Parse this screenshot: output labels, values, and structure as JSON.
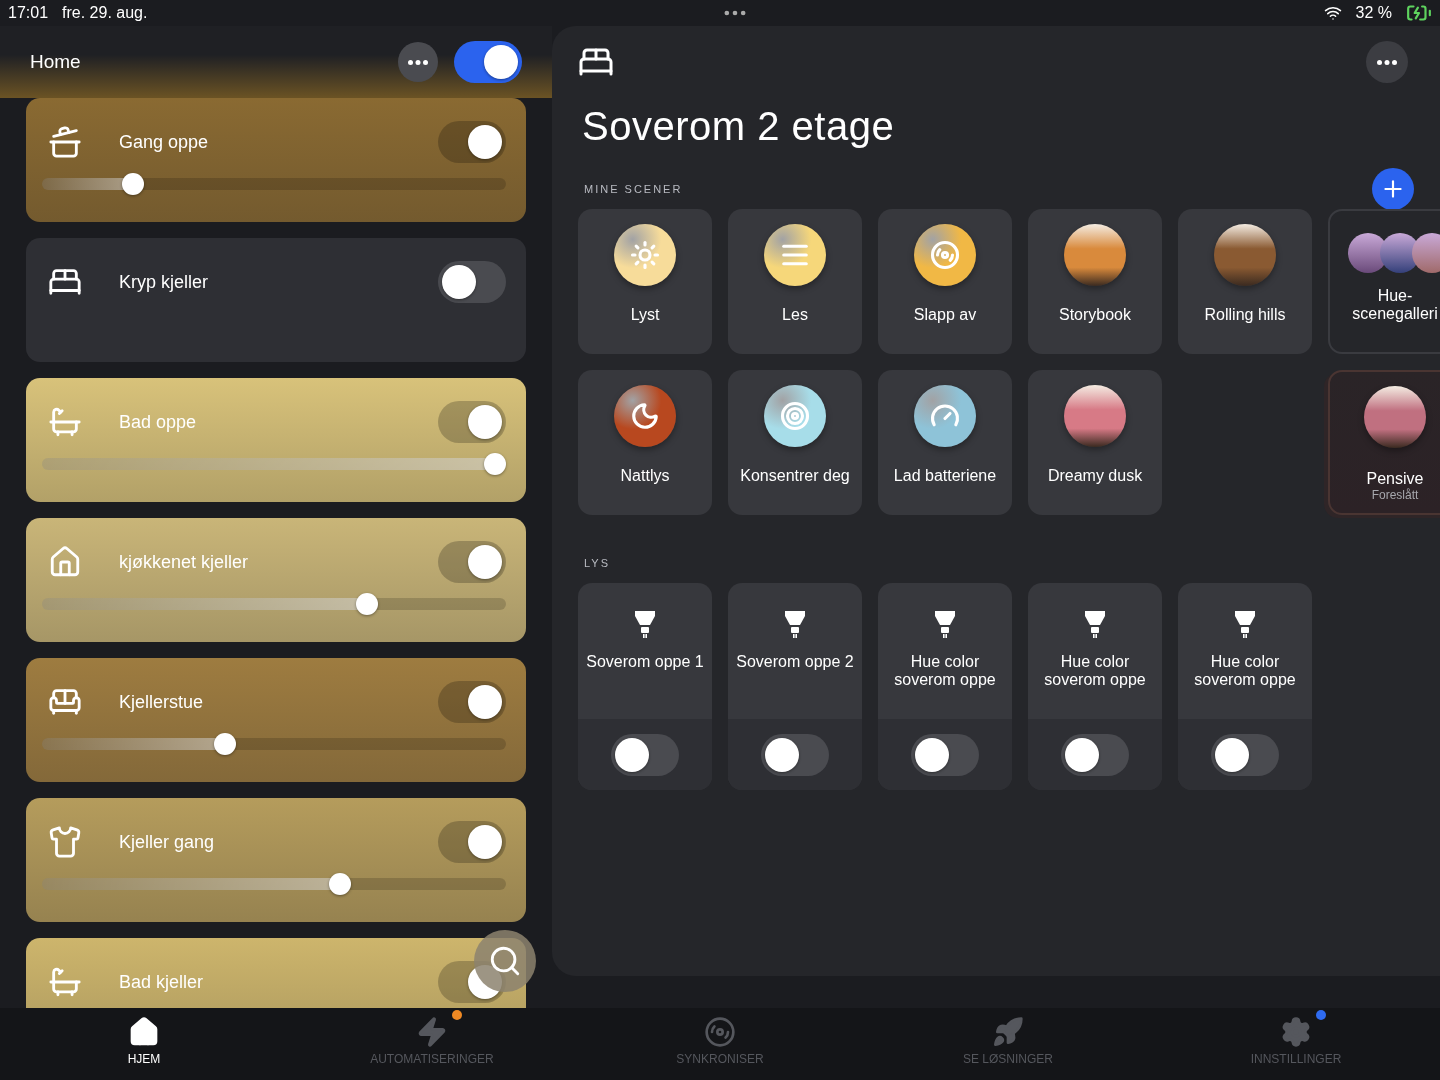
{
  "status_bar": {
    "time": "17:01",
    "date": "fre. 29. aug.",
    "battery": "32 %"
  },
  "home": {
    "title": "Home",
    "on": true
  },
  "rooms": [
    {
      "name": "Gang oppe",
      "kind": "pot",
      "on": true,
      "level": 0.18,
      "color": "#8a6a32"
    },
    {
      "name": "Kryp kjeller",
      "kind": "bed",
      "on": false,
      "color": "#2e2f34"
    },
    {
      "name": "Bad oppe",
      "kind": "bath",
      "on": true,
      "level": 1.0,
      "color": "#d8c27a"
    },
    {
      "name": "kjøkkenet kjeller",
      "kind": "house",
      "on": true,
      "level": 0.71,
      "color": "#c9b578"
    },
    {
      "name": "Kjellerstue",
      "kind": "sofa",
      "on": true,
      "level": 0.39,
      "color": "#9e7c40"
    },
    {
      "name": "Kjeller gang",
      "kind": "coat",
      "on": true,
      "level": 0.65,
      "color": "#b59c5c"
    },
    {
      "name": "Bad kjeller",
      "kind": "bath",
      "on": true,
      "color": "#cdb56c"
    }
  ],
  "room": {
    "title": "Soverom 2 etage"
  },
  "scenes_heading": "MINE SCENER",
  "scenes": [
    {
      "name": "Lyst",
      "kind": "sun",
      "color": "#f7dc9a"
    },
    {
      "name": "Les",
      "kind": "lines",
      "color": "#f6d77a"
    },
    {
      "name": "Slapp av",
      "kind": "swirl",
      "color": "#f1b845"
    },
    {
      "name": "Storybook",
      "kind": "photo",
      "color": "#d98a3c"
    },
    {
      "name": "Rolling hills",
      "kind": "photo",
      "color": "#8a5a32"
    },
    {
      "name": "Nattlys",
      "kind": "moon",
      "color": "#b8481f"
    },
    {
      "name": "Konsentrer deg",
      "kind": "rings",
      "color": "#a7dde9"
    },
    {
      "name": "Lad batteriene",
      "kind": "charge",
      "color": "#8ec3d8"
    },
    {
      "name": "Dreamy dusk",
      "kind": "photo",
      "color": "#d77a86"
    }
  ],
  "gallery": {
    "label": "Hue-scenegalleri"
  },
  "suggested": {
    "name": "Pensive",
    "note": "Foreslått"
  },
  "lights_heading": "LYS",
  "lights": [
    {
      "name": "Soverom oppe 1",
      "on": false
    },
    {
      "name": "Soverom oppe 2",
      "on": false
    },
    {
      "name": "Hue color soverom oppe",
      "on": false
    },
    {
      "name": "Hue color soverom oppe",
      "on": false
    },
    {
      "name": "Hue color soverom oppe",
      "on": false
    }
  ],
  "nav": [
    {
      "label": "HJEM",
      "kind": "home",
      "selected": true
    },
    {
      "label": "AUTOMATISERINGER",
      "kind": "bolt",
      "selected": false,
      "color": "#f08a24"
    },
    {
      "label": "SYNKRONISER",
      "kind": "sync",
      "selected": false
    },
    {
      "label": "SE LØSNINGER",
      "kind": "rocket",
      "selected": false
    },
    {
      "label": "INNSTILLINGER",
      "kind": "gear",
      "selected": false,
      "color": "#2f6bf0"
    }
  ]
}
